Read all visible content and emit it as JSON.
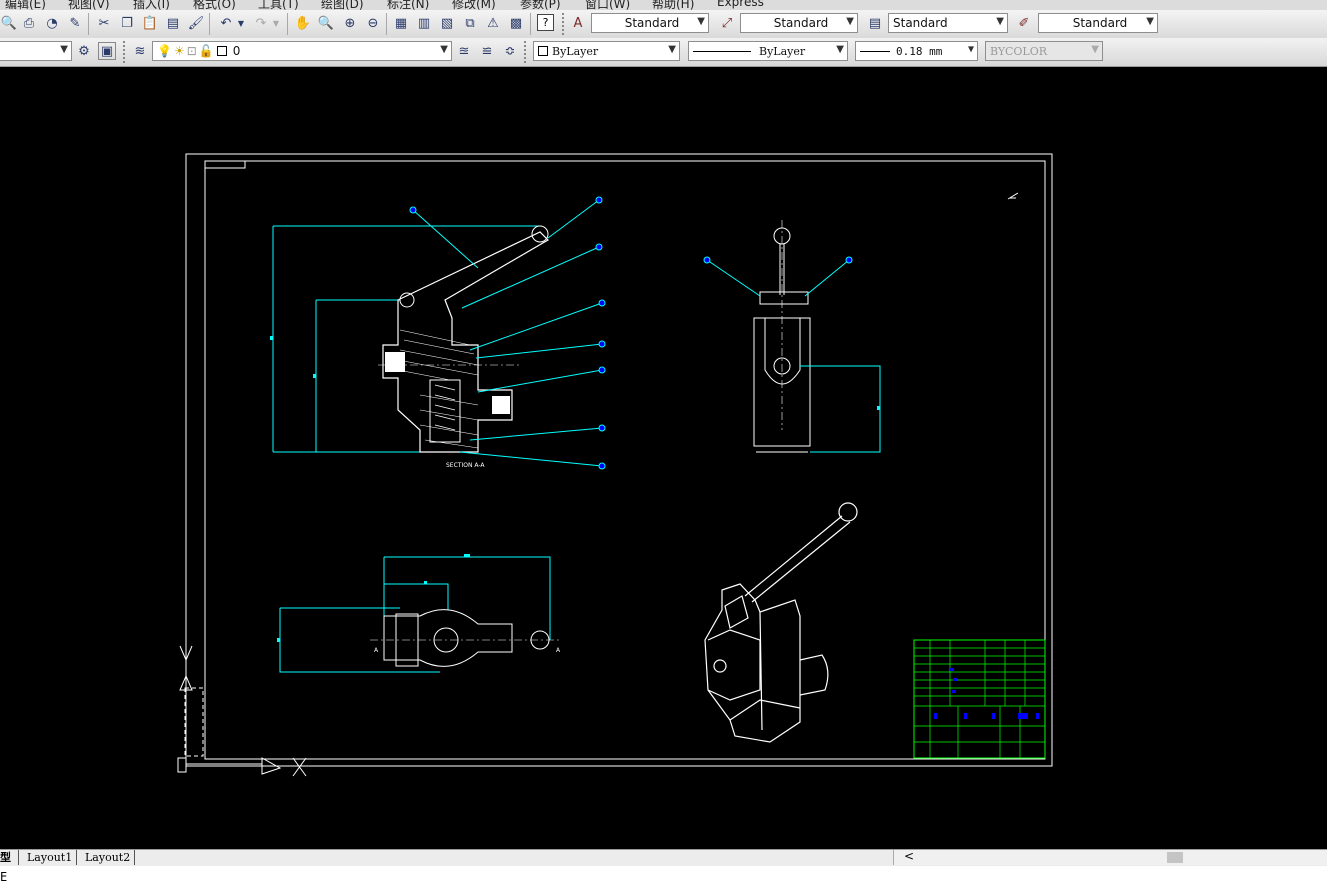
{
  "menu": [
    "编辑(E)",
    "视图(V)",
    "插入(I)",
    "格式(O)",
    "工具(T)",
    "绘图(D)",
    "标注(N)",
    "修改(M)",
    "参数(P)",
    "窗口(W)",
    "帮助(H)",
    "Express"
  ],
  "styles": {
    "text_style": "Standard",
    "dim_style": "Standard",
    "table_style": "Standard",
    "multileader_style": "Standard"
  },
  "layer": {
    "current": "0"
  },
  "properties": {
    "color": "ByLayer",
    "linetype": "ByLayer",
    "lineweight": "0.18 mm",
    "plotstyle": "BYCOLOR"
  },
  "help_label": "?",
  "drawing": {
    "section_label": "SECTION A-A",
    "section_mark": "A"
  },
  "tabs": {
    "model": "型",
    "layout1": "Layout1",
    "layout2": "Layout2"
  },
  "hscroll_left": "<",
  "command_text": "E",
  "colors": {
    "canvas": "#000000",
    "cyan": "#00ffff",
    "green": "#00ff00",
    "white": "#ffffff",
    "blue_marker": "#0000ff"
  }
}
